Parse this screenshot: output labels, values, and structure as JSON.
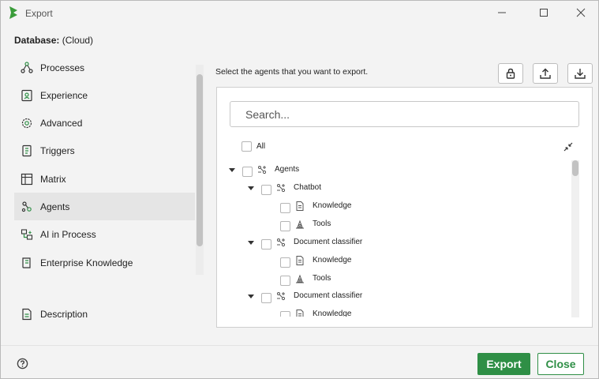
{
  "window": {
    "title": "Export",
    "controls": [
      "minimize-icon",
      "maximize-icon",
      "close-icon"
    ]
  },
  "database": {
    "label": "Database:",
    "value": "(Cloud)"
  },
  "sidebar": {
    "items": [
      {
        "label": "Processes",
        "icon": "processes-icon"
      },
      {
        "label": "Experience",
        "icon": "experience-icon"
      },
      {
        "label": "Advanced",
        "icon": "gear-icon"
      },
      {
        "label": "Triggers",
        "icon": "triggers-icon"
      },
      {
        "label": "Matrix",
        "icon": "matrix-icon"
      },
      {
        "label": "Agents",
        "icon": "agents-icon",
        "active": true
      },
      {
        "label": "AI in Process",
        "icon": "ai-process-icon"
      },
      {
        "label": "Enterprise Knowledge",
        "icon": "knowledge-book-icon"
      }
    ],
    "description": {
      "label": "Description",
      "icon": "document-icon"
    }
  },
  "main": {
    "instruction": "Select the agents that you want to export.",
    "toolbar": [
      "lock-icon",
      "upload-icon",
      "download-icon"
    ],
    "search_placeholder": "Search...",
    "all_label": "All",
    "tree": [
      {
        "label": "Agents",
        "level": 0,
        "expanded": true,
        "icon": "agent-icon"
      },
      {
        "label": "Chatbot",
        "level": 1,
        "expanded": true,
        "icon": "agent-icon"
      },
      {
        "label": "Knowledge",
        "level": 2,
        "icon": "document-icon"
      },
      {
        "label": "Tools",
        "level": 2,
        "icon": "tools-icon"
      },
      {
        "label": "Document classifier",
        "level": 1,
        "expanded": true,
        "icon": "agent-icon"
      },
      {
        "label": "Knowledge",
        "level": 2,
        "icon": "document-icon"
      },
      {
        "label": "Tools",
        "level": 2,
        "icon": "tools-icon"
      },
      {
        "label": "Document classifier",
        "level": 1,
        "expanded": true,
        "icon": "agent-icon"
      },
      {
        "label": "Knowledge",
        "level": 2,
        "icon": "document-icon"
      }
    ]
  },
  "footer": {
    "help_icon": "help-icon",
    "export_label": "Export",
    "close_label": "Close"
  },
  "colors": {
    "accent": "#2f8f46",
    "active_item": "#e5e5e5",
    "background": "#f3f3f3"
  }
}
